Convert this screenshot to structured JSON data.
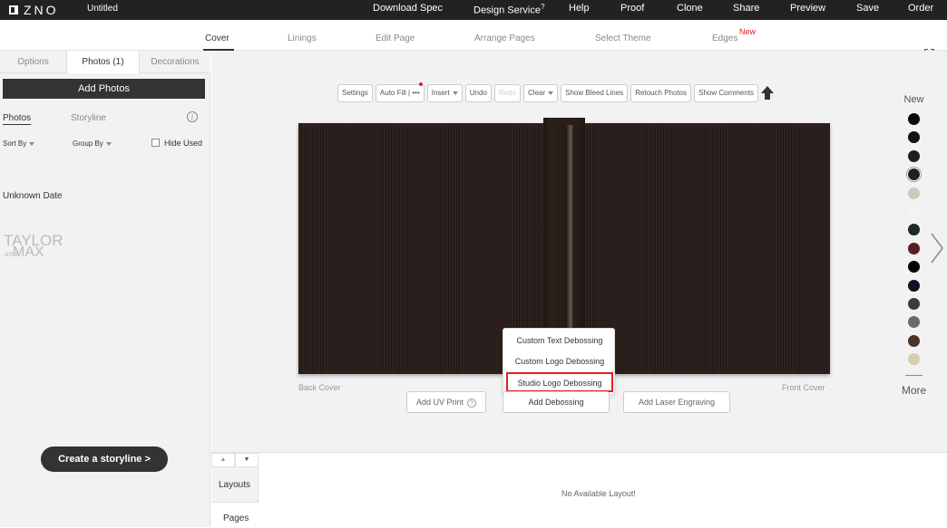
{
  "app": {
    "brand": "ZNO",
    "doc_title": "Untitled"
  },
  "topnav": {
    "download_spec": "Download Spec",
    "design_service": "Design Service",
    "design_service_badge": "?",
    "help": "Help",
    "proof": "Proof",
    "clone": "Clone",
    "share": "Share",
    "preview": "Preview",
    "save": "Save",
    "order": "Order"
  },
  "tabs": {
    "cover": "Cover",
    "linings": "Linings",
    "edit_page": "Edit Page",
    "arrange_pages": "Arrange Pages",
    "select_theme": "Select Theme",
    "edges": "Edges",
    "edges_badge": "New"
  },
  "left": {
    "subtabs": [
      "Options",
      "Photos (1)",
      "Decorations"
    ],
    "add_photos": "Add Photos",
    "photos": "Photos",
    "storyline": "Storyline",
    "info": "i",
    "sort_by": "Sort By",
    "group_by": "Group By",
    "hide_used": "Hide Used",
    "unknown_date": "Unknown Date",
    "studio_logo": {
      "line1": "TAYLOR",
      "amp": "and",
      "line2": "MAX"
    },
    "create_storyline": "Create a storyline >"
  },
  "toolbar": {
    "settings": "Settings",
    "auto_fill": "Auto Fill",
    "more": "•••",
    "insert": "Insert",
    "undo": "Undo",
    "redo": "Redo",
    "clear": "Clear",
    "show_bleed_lines": "Show Bleed Lines",
    "retouch_photos": "Retouch Photos",
    "show_comments": "Show Comments"
  },
  "canvas": {
    "back_cover": "Back Cover",
    "front_cover": "Front Cover",
    "add_uv_print": "Add UV Print",
    "help": "?",
    "add_debossing": "Add Debossing",
    "add_laser_engraving": "Add Laser Engraving"
  },
  "debossing_menu": {
    "custom_text": "Custom Text Debossing",
    "custom_logo": "Custom Logo Debossing",
    "studio_logo": "Studio Logo Debossing"
  },
  "colors": {
    "title": "New",
    "more": "More",
    "swatches": [
      "#0a0a0a",
      "#141414",
      "#1e1e1e",
      "#2a1e1b",
      "#cfc9bd",
      "#f4f4f4",
      "#1f2a22",
      "#5a1e26",
      "#050505",
      "#0c1322",
      "#3b3b3b",
      "#6a6a6a",
      "#4b3526",
      "#d8ccb0"
    ],
    "selected_index": 3
  },
  "bottom": {
    "layouts": "Layouts",
    "pages": "Pages",
    "no_layout": "No Available Layout!"
  }
}
